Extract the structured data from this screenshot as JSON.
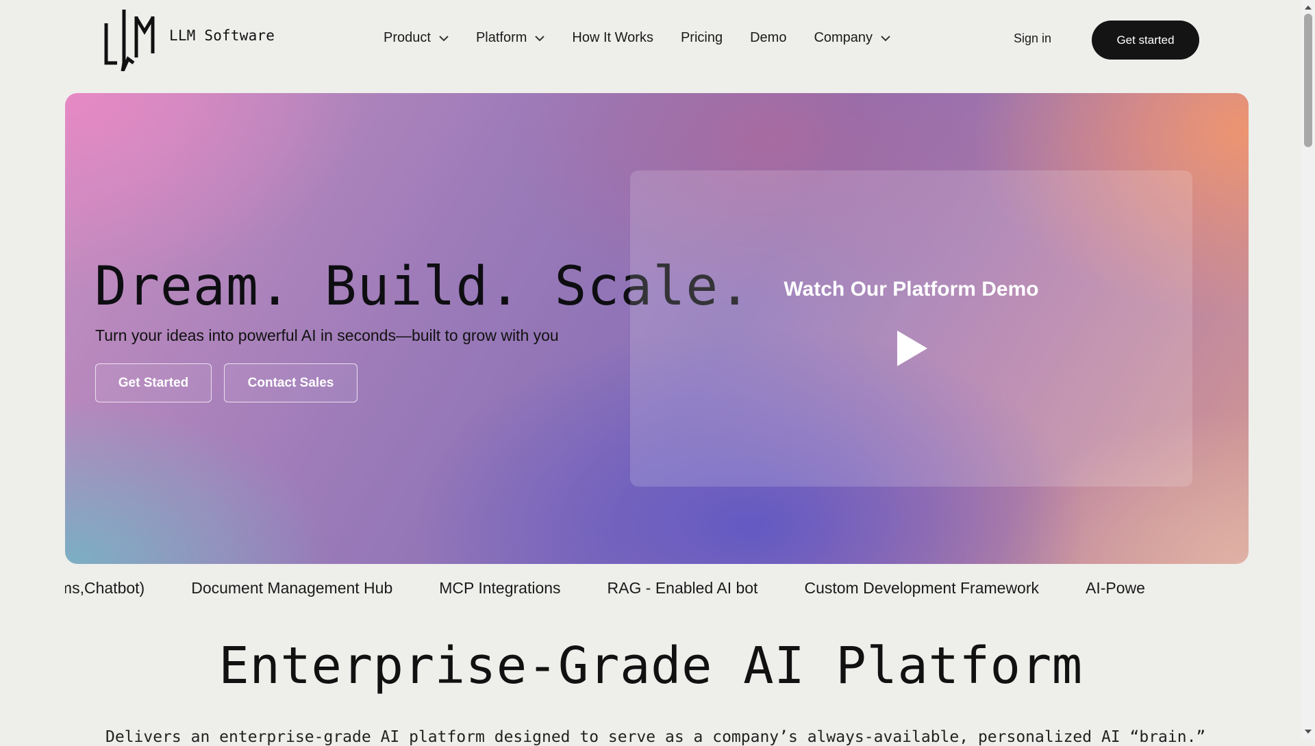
{
  "header": {
    "logo_text": "LLM Software",
    "nav": [
      {
        "label": "Product",
        "has_dropdown": true
      },
      {
        "label": "Platform",
        "has_dropdown": true
      },
      {
        "label": "How It Works",
        "has_dropdown": false
      },
      {
        "label": "Pricing",
        "has_dropdown": false
      },
      {
        "label": "Demo",
        "has_dropdown": false
      },
      {
        "label": "Company",
        "has_dropdown": true
      }
    ],
    "sign_in": "Sign in",
    "get_started": "Get started"
  },
  "hero": {
    "title": "Dream. Build. Scale.",
    "subtitle": "Turn your ideas into powerful AI in seconds—built to grow with you",
    "primary_button": "Get Started",
    "secondary_button": "Contact Sales",
    "video_title": "Watch Our Platform Demo",
    "play_icon": "play-icon"
  },
  "ticker": {
    "items": [
      "Voice , sms,Chatbot)",
      "Document Management Hub",
      "MCP Integrations",
      "RAG - Enabled AI bot",
      "Custom Development Framework",
      "AI-Powe"
    ]
  },
  "section": {
    "title": "Enterprise-Grade AI Platform",
    "body": "Delivers an enterprise-grade AI platform designed to serve as a company’s always-available, personalized AI “brain.” Built to leverage each"
  },
  "colors": {
    "page_bg": "#eeeeeb",
    "dark_button": "#141414",
    "text": "#111111"
  }
}
